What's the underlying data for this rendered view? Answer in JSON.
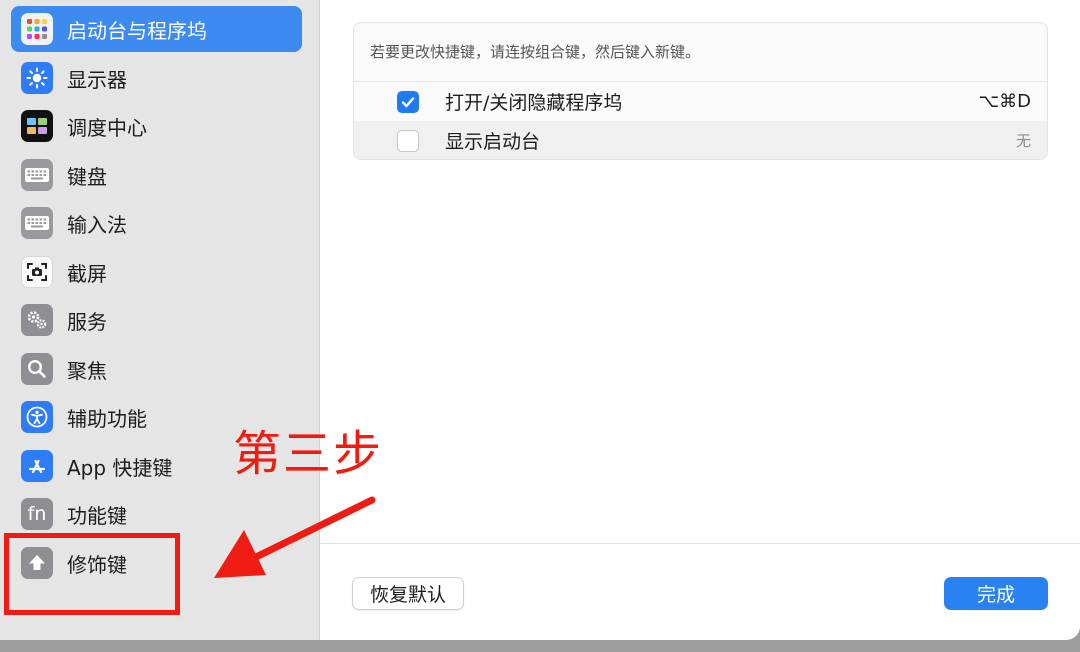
{
  "sidebar": {
    "items": [
      {
        "label": "启动台与程序坞",
        "icon": "launchpad-icon",
        "selected": true
      },
      {
        "label": "显示器",
        "icon": "display-icon"
      },
      {
        "label": "调度中心",
        "icon": "mission-control-icon"
      },
      {
        "label": "键盘",
        "icon": "keyboard-icon"
      },
      {
        "label": "输入法",
        "icon": "input-sources-icon"
      },
      {
        "label": "截屏",
        "icon": "screenshot-icon"
      },
      {
        "label": "服务",
        "icon": "services-icon"
      },
      {
        "label": "聚焦",
        "icon": "spotlight-icon"
      },
      {
        "label": "辅助功能",
        "icon": "accessibility-icon"
      },
      {
        "label": "App 快捷键",
        "icon": "app-shortcuts-icon"
      },
      {
        "label": "功能键",
        "icon": "function-keys-icon",
        "icon_text": "fn"
      },
      {
        "label": "修饰键",
        "icon": "modifier-keys-icon"
      }
    ]
  },
  "main": {
    "hint": "若要更改快捷键，请连按组合键，然后键入新键。",
    "shortcuts": [
      {
        "label": "打开/关闭隐藏程序坞",
        "key": "⌥⌘D",
        "checked": true
      },
      {
        "label": "显示启动台",
        "key": "无",
        "checked": false
      }
    ]
  },
  "footer": {
    "reset_label": "恢复默认",
    "done_label": "完成"
  },
  "annotation": {
    "text": "第三步",
    "color": "#ee1c13"
  },
  "colors": {
    "accent": "#2a82f2",
    "selected": "#3d8bf0",
    "sidebar_bg": "#e5e5e5"
  }
}
